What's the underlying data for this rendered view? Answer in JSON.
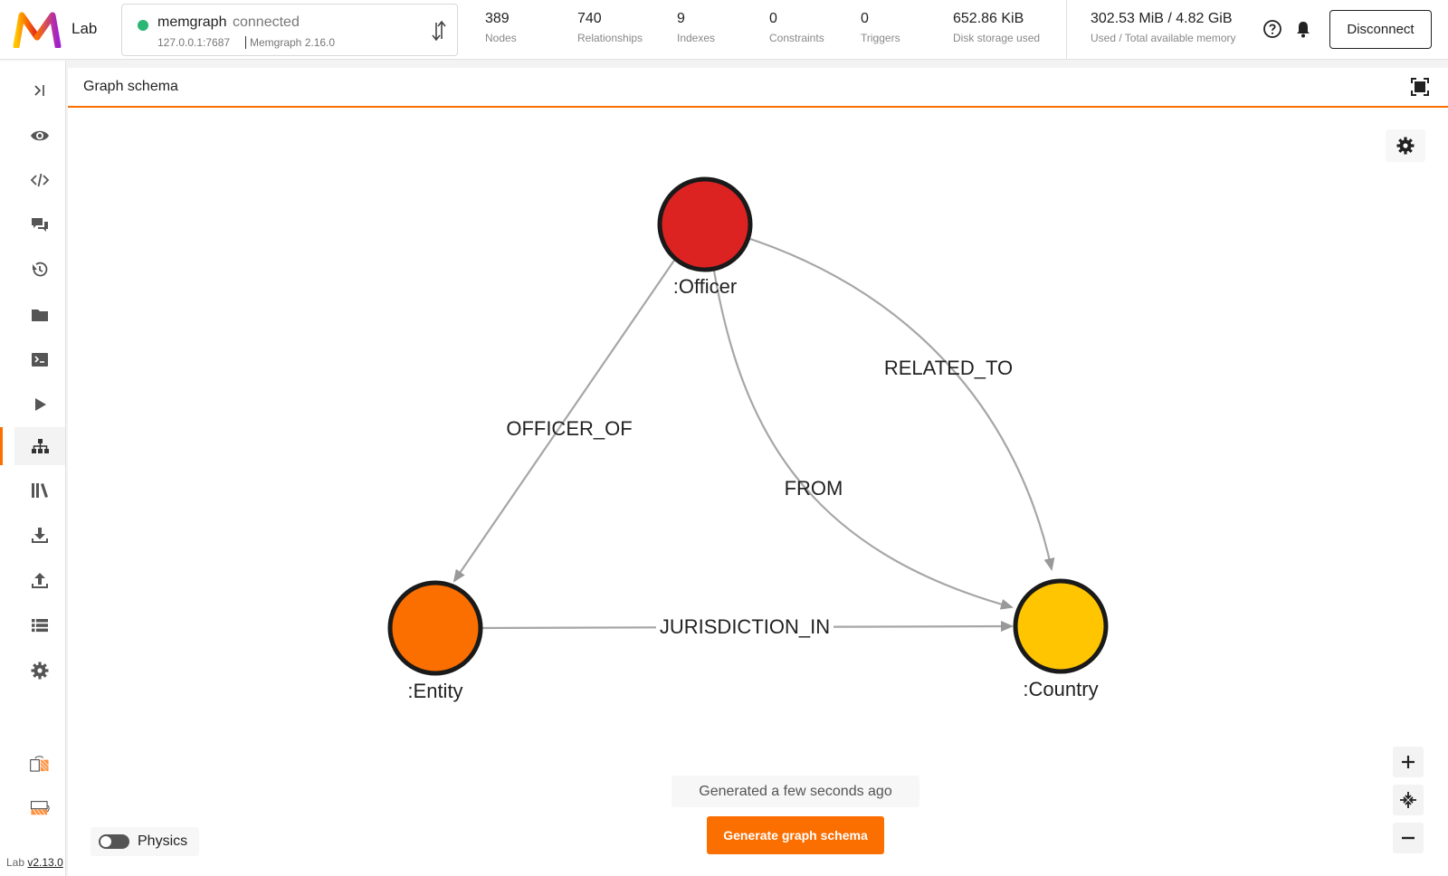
{
  "app": {
    "name": "Lab",
    "version_prefix": "Lab",
    "version": "v2.13.0"
  },
  "connection": {
    "name": "memgraph",
    "status": "connected",
    "address": "127.0.0.1:7687",
    "server_version": "Memgraph 2.16.0"
  },
  "stats": [
    {
      "value": "389",
      "label": "Nodes"
    },
    {
      "value": "740",
      "label": "Relationships"
    },
    {
      "value": "9",
      "label": "Indexes"
    },
    {
      "value": "0",
      "label": "Constraints"
    },
    {
      "value": "0",
      "label": "Triggers"
    },
    {
      "value": "652.86 KiB",
      "label": "Disk storage used"
    },
    {
      "value": "302.53 MiB / 4.82 GiB",
      "label": "Used / Total available memory"
    }
  ],
  "header_actions": {
    "disconnect_label": "Disconnect"
  },
  "panel": {
    "title": "Graph schema"
  },
  "graph": {
    "nodes": [
      {
        "id": "officer",
        "label": ":Officer",
        "color": "#dd2222"
      },
      {
        "id": "entity",
        "label": ":Entity",
        "color": "#fb6e00"
      },
      {
        "id": "country",
        "label": ":Country",
        "color": "#ffc500"
      }
    ],
    "edges": [
      {
        "from": "officer",
        "to": "entity",
        "label": "OFFICER_OF"
      },
      {
        "from": "officer",
        "to": "country",
        "label": "FROM"
      },
      {
        "from": "officer",
        "to": "country",
        "label": "RELATED_TO"
      },
      {
        "from": "entity",
        "to": "country",
        "label": "JURISDICTION_IN"
      }
    ]
  },
  "footer": {
    "generated_text": "Generated a few seconds ago",
    "generate_button": "Generate graph schema",
    "physics_label": "Physics",
    "physics_enabled": false
  },
  "sidebar_icons": [
    "expand-sidebar-icon",
    "eye-icon",
    "code-icon",
    "chat-icon",
    "history-icon",
    "folder-icon",
    "terminal-icon",
    "play-icon",
    "graph-schema-icon",
    "library-icon",
    "import-icon",
    "export-icon",
    "list-icon",
    "settings-icon",
    "layout-icon",
    "layout-alt-icon"
  ],
  "colors": {
    "accent": "#fb6e00",
    "connected": "#2bb673"
  }
}
